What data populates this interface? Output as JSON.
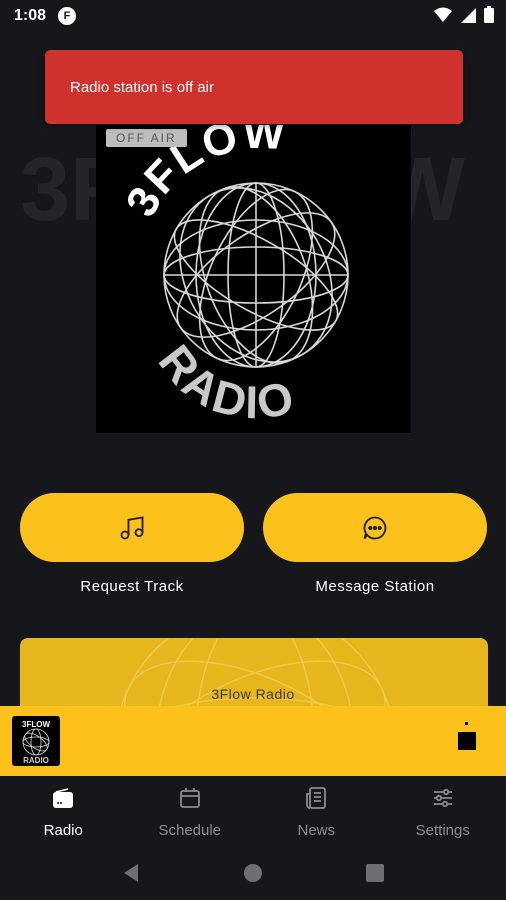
{
  "status_bar": {
    "time": "1:08",
    "app_icon_letter": "F"
  },
  "snackbar": {
    "message": "Radio station is off air"
  },
  "cover": {
    "badge": "OFF AIR",
    "logo_top": "3FLOW",
    "logo_bottom": "RADIO"
  },
  "actions": [
    {
      "label": "Request Track",
      "icon": "music-note-icon"
    },
    {
      "label": "Message Station",
      "icon": "chat-bubble-icon"
    }
  ],
  "banner": {
    "title": "3Flow Radio"
  },
  "mini_player": {
    "thumb_top": "3FLOW",
    "thumb_bottom": "RADIO",
    "control": "stop-icon"
  },
  "nav": [
    {
      "label": "Radio",
      "icon": "radio-icon",
      "active": true
    },
    {
      "label": "Schedule",
      "icon": "calendar-icon",
      "active": false
    },
    {
      "label": "News",
      "icon": "newspaper-icon",
      "active": false
    },
    {
      "label": "Settings",
      "icon": "sliders-icon",
      "active": false
    }
  ],
  "colors": {
    "accent": "#fcc21b",
    "background": "#15171b",
    "error": "#cf312d"
  }
}
